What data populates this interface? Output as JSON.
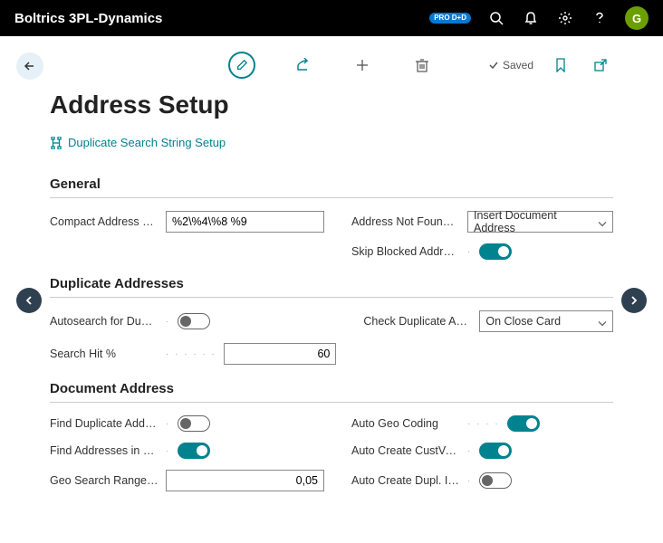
{
  "topbar": {
    "title": "Boltrics 3PL-Dynamics",
    "pro_badge": "PRO D+D",
    "avatar_letter": "G"
  },
  "toolbar": {
    "saved_label": "Saved"
  },
  "page_title": "Address Setup",
  "action_link": "Duplicate Search String Setup",
  "sections": {
    "general": {
      "title": "General",
      "compact_label": "Compact Address F…",
      "compact_value": "%2\\%4\\%8 %9",
      "not_found_label": "Address Not Found …",
      "not_found_value": "Insert Document Address",
      "skip_blocked_label": "Skip Blocked Addre…"
    },
    "duplicates": {
      "title": "Duplicate Addresses",
      "autosearch_label": "Autosearch for Dupl…",
      "hit_label": "Search Hit %",
      "hit_value": "60",
      "check_label": "Check Duplicate Ad…",
      "check_value": "On Close Card"
    },
    "document": {
      "title": "Document Address",
      "find_dup_label": "Find Duplicate Addr…",
      "find_geo_label": "Find Addresses in G…",
      "range_label": "Geo Search Range (…",
      "range_value": "0,05",
      "auto_geo_label": "Auto Geo Coding",
      "auto_cust_label": "Auto Create CustVe…",
      "auto_dupl_label": "Auto Create Dupl. In…"
    }
  }
}
